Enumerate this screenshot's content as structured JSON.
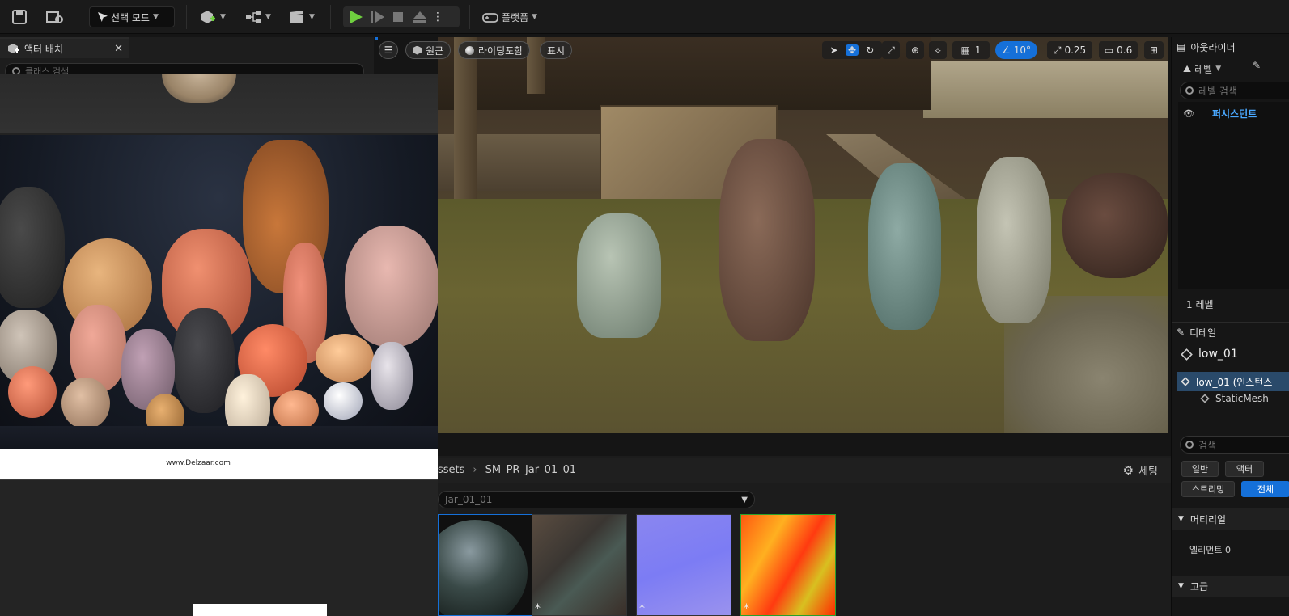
{
  "toolbar": {
    "mode_label": "선택 모드",
    "platform_label": "플랫폼"
  },
  "place_actors": {
    "tab_label": "액터 배치",
    "search_placeholder": "클래스 검색"
  },
  "reference_image": {
    "caption": "www.Delzaar.com"
  },
  "viewport": {
    "perspective_label": "원근",
    "lighting_label": "라이팅포함",
    "show_label": "표시",
    "grid_value": "1",
    "angle_value": "10°",
    "scale_value": "0.25",
    "camera_speed": "0.6"
  },
  "content_browser": {
    "breadcrumb_prev": "ssets",
    "breadcrumb_current": "SM_PR_Jar_01_01",
    "settings_label": "세팅",
    "dropdown_value": "Jar_01_01"
  },
  "outliner": {
    "title": "아웃라이너",
    "level_button": "레벨",
    "search_placeholder": "레벨 검색",
    "persistent_item": "퍼시스턴트",
    "level_count": "1 레벨"
  },
  "details": {
    "title": "디테일",
    "object_name": "low_01",
    "instance_row": "low_01 (인스턴스",
    "component_row": "StaticMesh",
    "search_placeholder": "검색",
    "filter_general": "일반",
    "filter_actor": "액터",
    "filter_streaming": "스트리밍",
    "filter_all": "전체",
    "material_section": "머티리얼",
    "element_label": "엘리먼트 0",
    "advanced_section": "고급"
  },
  "colors": {
    "accent": "#1570d9",
    "play_green": "#6fcf3f"
  }
}
